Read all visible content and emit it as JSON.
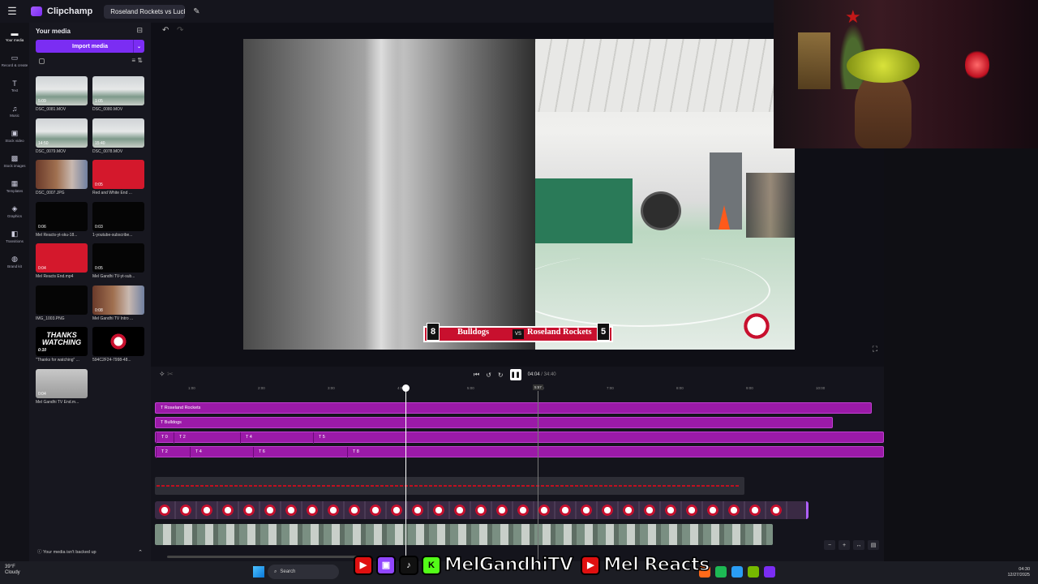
{
  "app": {
    "name": "Clipchamp",
    "project_tab": "Roseland Rockets vs Lucky L"
  },
  "nav": [
    {
      "label": "Your media",
      "icon": "folder-icon"
    },
    {
      "label": "Record & create",
      "icon": "camera-icon"
    },
    {
      "label": "Text",
      "icon": "text-icon"
    },
    {
      "label": "Music",
      "icon": "music-icon"
    },
    {
      "label": "Stock video",
      "icon": "film-icon"
    },
    {
      "label": "Stock images",
      "icon": "image-icon"
    },
    {
      "label": "Templates",
      "icon": "template-icon"
    },
    {
      "label": "Graphics",
      "icon": "shapes-icon"
    },
    {
      "label": "Transitions",
      "icon": "transition-icon"
    },
    {
      "label": "Brand kit",
      "icon": "brand-icon"
    }
  ],
  "media": {
    "title": "Your media",
    "import_label": "Import media",
    "backup_text": "Your media isn't backed up",
    "items": [
      {
        "name": "DSC_0081.MOV",
        "dur": "5:09"
      },
      {
        "name": "DSC_0080.MOV",
        "dur": "1:05"
      },
      {
        "name": "DSC_0079.MOV",
        "dur": "14:50"
      },
      {
        "name": "DSC_0078.MOV",
        "dur": "15:40"
      },
      {
        "name": "DSC_0007.JPG",
        "dur": ""
      },
      {
        "name": "Red and White End ...",
        "dur": "0:05"
      },
      {
        "name": "Mel Reacts-yt-sku-18...",
        "dur": "0:06"
      },
      {
        "name": "1-youtube-subscribe...",
        "dur": "0:03"
      },
      {
        "name": "Mel Reacts End.mp4",
        "dur": "0:04"
      },
      {
        "name": "Mel Gandhi TV-yt-sub...",
        "dur": "0:05"
      },
      {
        "name": "IMG_1003.PNG",
        "dur": ""
      },
      {
        "name": "Mel Gandhi TV Intro ...",
        "dur": "0:08"
      },
      {
        "name": "\"Thanks for watching\" ...",
        "dur": "0:10"
      },
      {
        "name": "594C2F24-7998-48...",
        "dur": ""
      },
      {
        "name": "Mel Gandhi TV End.m...",
        "dur": "0:04"
      }
    ]
  },
  "scoreboard": {
    "home_score": "8",
    "home_team": "Bulldogs",
    "vs": "VS",
    "away_team": "Roseland Rockets",
    "away_score": "5"
  },
  "playback": {
    "current": "04:04",
    "total": "/ 34:40",
    "marker": "5:57"
  },
  "ruler": [
    "1:00",
    "2:00",
    "3:00",
    "4:00",
    "5:00",
    "6:00",
    "7:00",
    "8:00",
    "9:00",
    "10:00"
  ],
  "tracks": {
    "t1": "Roseland Rockets",
    "t2": "Bulldogs",
    "t3": [
      "0",
      "2",
      "4",
      "5"
    ],
    "t4": [
      "2",
      "4",
      "6",
      "8"
    ]
  },
  "taskbar": {
    "temp": "39°F",
    "weather": "Cloudy",
    "search": "Search",
    "time": "04:30",
    "date": "12/27/2025"
  },
  "banner": {
    "channel1": "MelGandhiTV",
    "channel2": "Mel Reacts"
  }
}
